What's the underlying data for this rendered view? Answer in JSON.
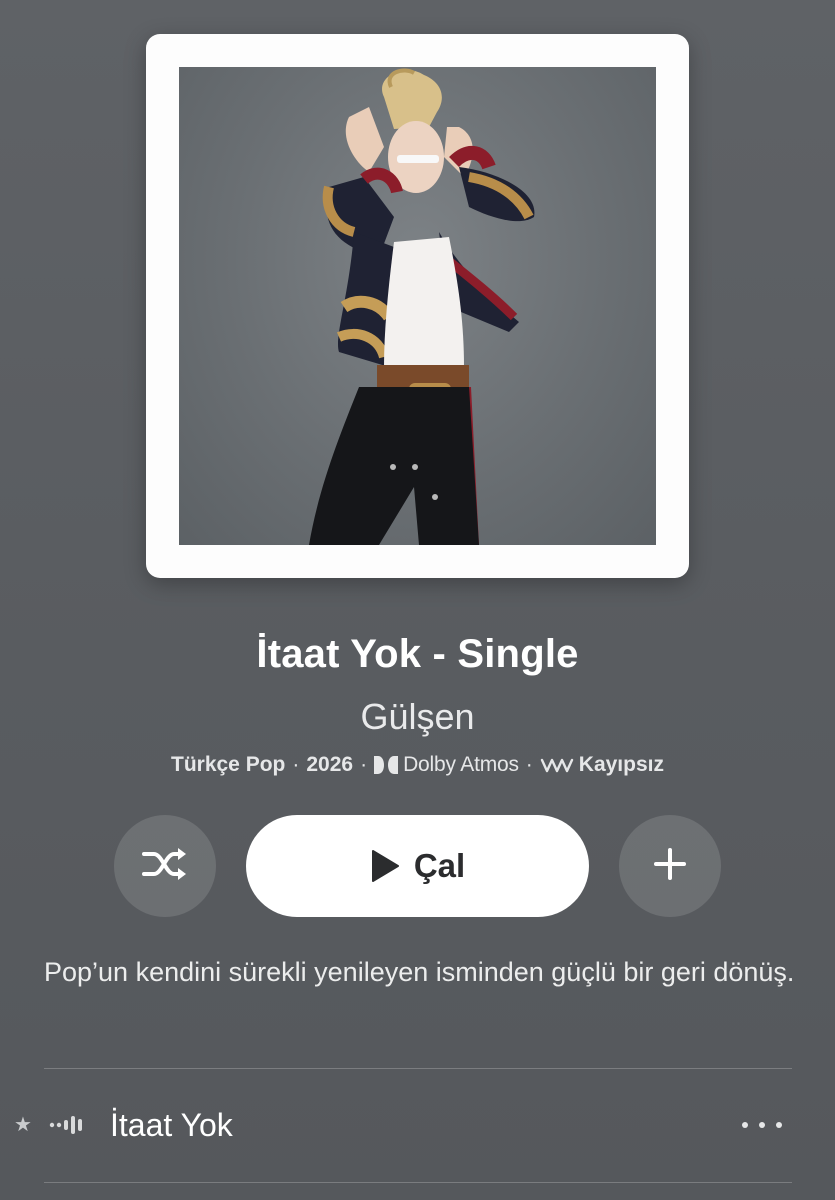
{
  "album": {
    "title": "İtaat Yok - Single",
    "artist": "Gülşen",
    "genre": "Türkçe Pop",
    "year": "2026",
    "dolby_label": "Dolby Atmos",
    "lossless_label": "Kayıpsız",
    "separator": "·",
    "artwork_icon": "album-artwork-image"
  },
  "controls": {
    "play_label": "Çal",
    "shuffle_icon": "shuffle-icon",
    "add_icon": "plus-icon",
    "play_icon": "play-icon"
  },
  "description": "Pop’un kendini sürekli yenileyen isminden güçlü bir geri dönüş.",
  "tracks": [
    {
      "title": "İtaat Yok",
      "star": "★",
      "now_playing_icon": "waveform-icon",
      "more_icon": "ellipsis-icon"
    }
  ],
  "colors": {
    "background": "#5d6064",
    "play_button_bg": "#ffffff",
    "play_button_text": "#2b2c2e",
    "secondary_button_bg": "rgba(255,255,255,0.13)"
  }
}
